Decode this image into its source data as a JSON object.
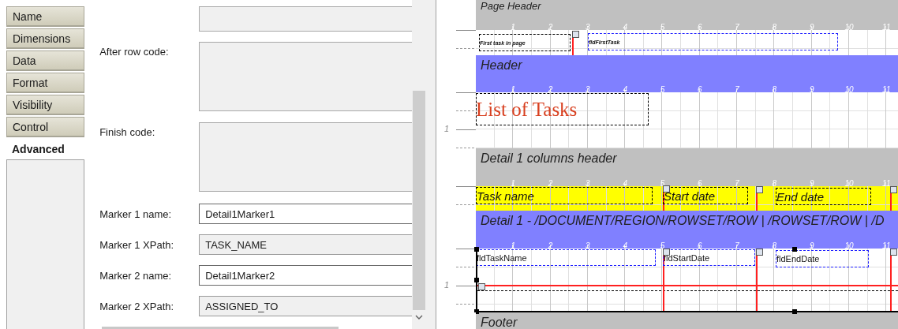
{
  "properties_panel": {
    "tabs": [
      {
        "label": "Name",
        "selected": false
      },
      {
        "label": "Dimensions",
        "selected": false
      },
      {
        "label": "Data",
        "selected": false
      },
      {
        "label": "Format",
        "selected": false
      },
      {
        "label": "Visibility",
        "selected": false
      },
      {
        "label": "Control",
        "selected": false
      },
      {
        "label": "Advanced",
        "selected": true
      }
    ],
    "fields": [
      {
        "kind": "textarea"
      },
      {
        "kind": "textarea",
        "label": "After row code:"
      },
      {
        "kind": "textarea",
        "label": "Finish code:"
      },
      {
        "kind": "input",
        "label": "Marker 1 name:",
        "value": "Detail1Marker1",
        "readonly": false
      },
      {
        "kind": "input",
        "label": "Marker 1 XPath:",
        "value": "TASK_NAME",
        "readonly": true
      },
      {
        "kind": "input",
        "label": "Marker 2 name:",
        "value": "Detail1Marker2",
        "readonly": false
      },
      {
        "kind": "input",
        "label": "Marker 2 XPath:",
        "value": "ASSIGNED_TO",
        "readonly": true
      }
    ]
  },
  "designer": {
    "parts": [
      {
        "kind": "band",
        "title": "Page Header",
        "color": "#c0c0c0",
        "ruler": [
          "1",
          "2",
          "3",
          "4",
          "5",
          "6",
          "7",
          "8",
          "9",
          "10",
          "11"
        ]
      },
      {
        "kind": "section",
        "color": "#ffffff",
        "items": [
          {
            "kind": "label",
            "text": "First task in page"
          },
          {
            "kind": "field",
            "text": "fldFirstTask"
          }
        ]
      },
      {
        "kind": "band",
        "title": "Header",
        "color": "#8080ff",
        "ruler": [
          "1",
          "2",
          "3",
          "4",
          "5",
          "6",
          "7",
          "8",
          "9",
          "10",
          "11"
        ]
      },
      {
        "kind": "section",
        "color": "#ffffff",
        "side_label": "1",
        "items": [
          {
            "kind": "title",
            "text": "List of Tasks"
          }
        ]
      },
      {
        "kind": "band",
        "title": "Detail 1 columns header",
        "color": "#c0c0c0",
        "ruler": [
          "1",
          "2",
          "3",
          "4",
          "5",
          "6",
          "7",
          "8",
          "9",
          "10",
          "11"
        ]
      },
      {
        "kind": "section",
        "color": "#ffff00",
        "items": [
          {
            "kind": "label",
            "text": "Task name"
          },
          {
            "kind": "label",
            "text": "Start date"
          },
          {
            "kind": "label",
            "text": "End date"
          }
        ]
      },
      {
        "kind": "band",
        "title": "Detail 1 - /DOCUMENT/REGION/ROWSET/ROW | /ROWSET/ROW | /D",
        "color": "#8080ff",
        "ruler": [
          "1",
          "2",
          "3",
          "4",
          "5",
          "6",
          "7",
          "8",
          "9",
          "10",
          "11"
        ]
      },
      {
        "kind": "section",
        "color": "#ffffff",
        "side_label": "1",
        "items": [
          {
            "kind": "field",
            "text": "fldTaskName"
          },
          {
            "kind": "field",
            "text": "fldStartDate"
          },
          {
            "kind": "field",
            "text": "fldEndDate"
          }
        ]
      },
      {
        "kind": "band",
        "title": "Footer",
        "color": "#c0c0c0"
      }
    ]
  }
}
